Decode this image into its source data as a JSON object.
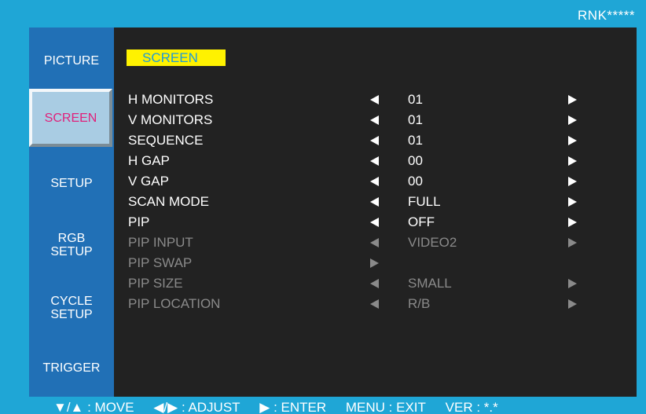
{
  "model": "RNK*****",
  "sidebar": {
    "items": [
      {
        "label": "PICTURE"
      },
      {
        "label": "SCREEN"
      },
      {
        "label": "SETUP"
      },
      {
        "label_line1": "RGB",
        "label_line2": "SETUP"
      },
      {
        "label_line1": "CYCLE",
        "label_line2": "SETUP"
      },
      {
        "label": "TRIGGER"
      }
    ],
    "active": "SCREEN"
  },
  "panel": {
    "title": "SCREEN"
  },
  "rows": [
    {
      "label": "H MONITORS",
      "value": "01",
      "enabled": true
    },
    {
      "label": "V MONITORS",
      "value": "01",
      "enabled": true
    },
    {
      "label": "SEQUENCE",
      "value": "01",
      "enabled": true
    },
    {
      "label": "H GAP",
      "value": "00",
      "enabled": true
    },
    {
      "label": "V GAP",
      "value": "00",
      "enabled": true
    },
    {
      "label": "SCAN MODE",
      "value": "FULL",
      "enabled": true
    },
    {
      "label": "PIP",
      "value": "OFF",
      "enabled": true
    },
    {
      "label": "PIP INPUT",
      "value": "VIDEO2",
      "enabled": false
    },
    {
      "label": "PIP SWAP",
      "value": "",
      "enabled": false
    },
    {
      "label": "PIP SIZE",
      "value": "SMALL",
      "enabled": false
    },
    {
      "label": "PIP LOCATION",
      "value": "R/B",
      "enabled": false
    }
  ],
  "footer": {
    "move": "▼/▲ : MOVE",
    "adjust": "◀/▶ : ADJUST",
    "enter": "▶ : ENTER",
    "exit": "MENU : EXIT",
    "version": "VER : *.*"
  },
  "colors": {
    "background": "#1fa6d6",
    "panel": "#222222",
    "sidebar": "#2170b6",
    "active_item_bg": "#a9cce3",
    "active_item_text": "#e0217b",
    "title_bg": "#fff200",
    "disabled_text": "#8a8a8a"
  }
}
